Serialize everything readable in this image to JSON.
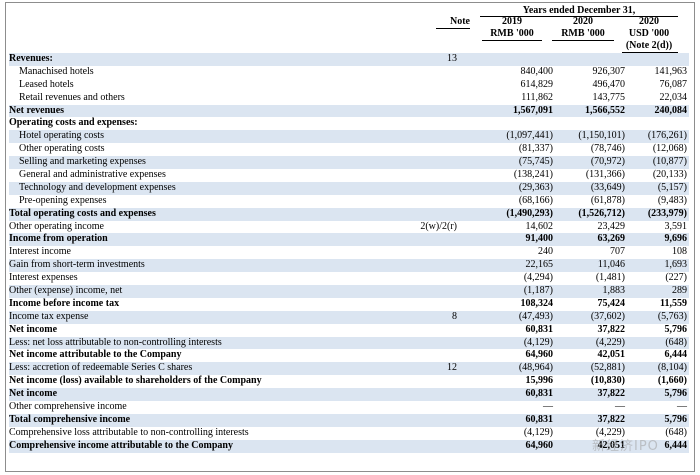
{
  "header": {
    "note": "Note",
    "period": "Years ended December 31,",
    "columns": [
      {
        "year": "2019",
        "unit": "RMB '000",
        "extra": ""
      },
      {
        "year": "2020",
        "unit": "RMB '000",
        "extra": ""
      },
      {
        "year": "2020",
        "unit": "USD '000",
        "extra": "(Note 2(d))"
      }
    ]
  },
  "rows": [
    {
      "label": "Revenues:",
      "note": "13",
      "v": [
        "",
        "",
        ""
      ],
      "style": "bold blue"
    },
    {
      "label": "Manachised hotels",
      "note": "",
      "v": [
        "840,400",
        "926,307",
        "141,963"
      ],
      "style": "ind"
    },
    {
      "label": "Leased hotels",
      "note": "",
      "v": [
        "614,829",
        "496,470",
        "76,087"
      ],
      "style": "ind"
    },
    {
      "label": "Retail revenues and others",
      "note": "",
      "v": [
        "111,862",
        "143,775",
        "22,034"
      ],
      "style": "ind"
    },
    {
      "label": "Net revenues",
      "note": "",
      "v": [
        "1,567,091",
        "1,566,552",
        "240,084"
      ],
      "style": "bold blue"
    },
    {
      "label": "Operating costs and expenses:",
      "note": "",
      "v": [
        "",
        "",
        ""
      ],
      "style": "bold"
    },
    {
      "label": "Hotel operating costs",
      "note": "",
      "v": [
        "(1,097,441)",
        "(1,150,101)",
        "(176,261)"
      ],
      "style": "ind blue"
    },
    {
      "label": "Other operating costs",
      "note": "",
      "v": [
        "(81,337)",
        "(78,746)",
        "(12,068)"
      ],
      "style": "ind"
    },
    {
      "label": "Selling and marketing expenses",
      "note": "",
      "v": [
        "(75,745)",
        "(70,972)",
        "(10,877)"
      ],
      "style": "ind blue"
    },
    {
      "label": "General and administrative expenses",
      "note": "",
      "v": [
        "(138,241)",
        "(131,366)",
        "(20,133)"
      ],
      "style": "ind"
    },
    {
      "label": "Technology and development expenses",
      "note": "",
      "v": [
        "(29,363)",
        "(33,649)",
        "(5,157)"
      ],
      "style": "ind blue"
    },
    {
      "label": "Pre-opening expenses",
      "note": "",
      "v": [
        "(68,166)",
        "(61,878)",
        "(9,483)"
      ],
      "style": "ind"
    },
    {
      "label": "Total operating costs and expenses",
      "note": "",
      "v": [
        "(1,490,293)",
        "(1,526,712)",
        "(233,979)"
      ],
      "style": "bold blue"
    },
    {
      "label": "Other operating income",
      "note": "2(w)/2(r)",
      "v": [
        "14,602",
        "23,429",
        "3,591"
      ],
      "style": ""
    },
    {
      "label": "Income from operation",
      "note": "",
      "v": [
        "91,400",
        "63,269",
        "9,696"
      ],
      "style": "bold blue"
    },
    {
      "label": "Interest income",
      "note": "",
      "v": [
        "240",
        "707",
        "108"
      ],
      "style": ""
    },
    {
      "label": "Gain from short-term investments",
      "note": "",
      "v": [
        "22,165",
        "11,046",
        "1,693"
      ],
      "style": "blue"
    },
    {
      "label": "Interest expenses",
      "note": "",
      "v": [
        "(4,294)",
        "(1,481)",
        "(227)"
      ],
      "style": ""
    },
    {
      "label": "Other (expense) income, net",
      "note": "",
      "v": [
        "(1,187)",
        "1,883",
        "289"
      ],
      "style": "blue"
    },
    {
      "label": "Income before income tax",
      "note": "",
      "v": [
        "108,324",
        "75,424",
        "11,559"
      ],
      "style": "bold"
    },
    {
      "label": "Income tax expense",
      "note": "8",
      "v": [
        "(47,493)",
        "(37,602)",
        "(5,763)"
      ],
      "style": "blue"
    },
    {
      "label": "Net income",
      "note": "",
      "v": [
        "60,831",
        "37,822",
        "5,796"
      ],
      "style": "bold"
    },
    {
      "label": "Less: net loss attributable to non-controlling interests",
      "note": "",
      "v": [
        "(4,129)",
        "(4,229)",
        "(648)"
      ],
      "style": "blue"
    },
    {
      "label": "Net income attributable to the Company",
      "note": "",
      "v": [
        "64,960",
        "42,051",
        "6,444"
      ],
      "style": "bold"
    },
    {
      "label": "Less: accretion of redeemable Series C shares",
      "note": "12",
      "v": [
        "(48,964)",
        "(52,881)",
        "(8,104)"
      ],
      "style": "blue"
    },
    {
      "label": "Net income (loss) available to shareholders of the Company",
      "note": "",
      "v": [
        "15,996",
        "(10,830)",
        "(1,660)"
      ],
      "style": "bold"
    },
    {
      "label": "Net income",
      "note": "",
      "v": [
        "60,831",
        "37,822",
        "5,796"
      ],
      "style": "bold blue"
    },
    {
      "label": "Other comprehensive income",
      "note": "",
      "v": [
        "—",
        "—",
        "—"
      ],
      "style": ""
    },
    {
      "label": "Total comprehensive income",
      "note": "",
      "v": [
        "60,831",
        "37,822",
        "5,796"
      ],
      "style": "bold blue"
    },
    {
      "label": "Comprehensive loss attributable to non-controlling interests",
      "note": "",
      "v": [
        "(4,129)",
        "(4,229)",
        "(648)"
      ],
      "style": ""
    },
    {
      "label": "Comprehensive income attributable to the Company",
      "note": "",
      "v": [
        "64,960",
        "42,051",
        "6,444"
      ],
      "style": "bold blue"
    }
  ],
  "watermark": "新经济IPO"
}
